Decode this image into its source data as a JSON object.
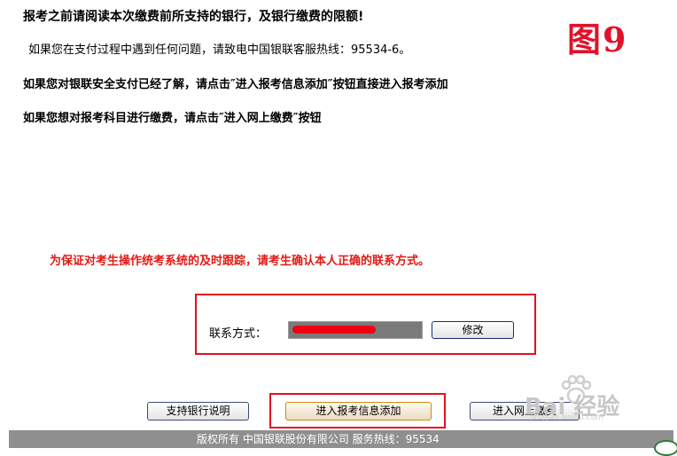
{
  "notice": {
    "line1": "报考之前请阅读本次缴费前所支持的银行，及银行缴费的限额!",
    "line2": "如果您在支付过程中遇到任何问题，请致电中国银联客服热线：95534-6。",
    "line3": "如果您对银联安全支付已经了解，请点击″进入报考信息添加″按钮直接进入报考添加",
    "line4": "如果您想对报考科目进行缴费，请点击″进入网上缴费″按钮"
  },
  "figure_label": "图9",
  "warning": "为保证对考生操作统考系统的及时跟踪，请考生确认本人正确的联系方式。",
  "contact": {
    "label": "联系方式：",
    "modify_label": "修改"
  },
  "buttons": {
    "bank_info": "支持银行说明",
    "add_info": "进入报考信息添加",
    "online_pay": "进入网上缴费"
  },
  "footer": {
    "text": "版权所有  中国银联股份有限公司      服务热线：95534"
  },
  "watermark": {
    "text": "Bai 经验",
    "url": "jingyan.baidu.com"
  },
  "colors": {
    "highlight_red": "#e2121e",
    "footer_bg": "#8f8f8f"
  }
}
